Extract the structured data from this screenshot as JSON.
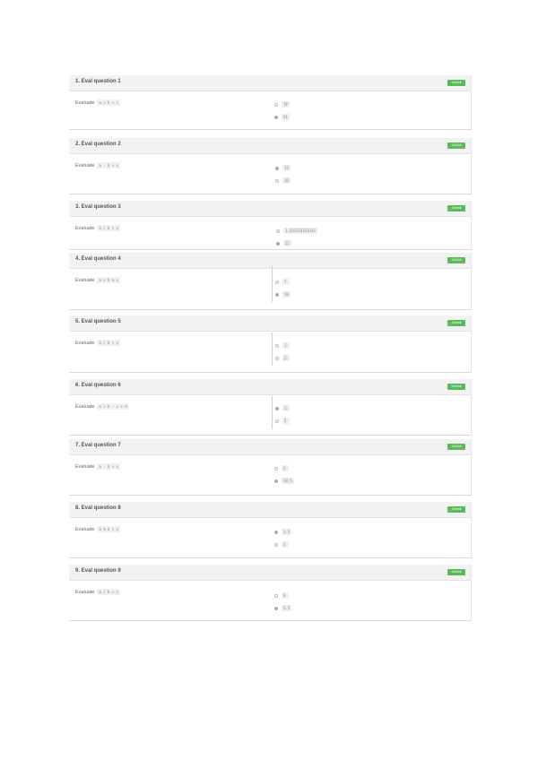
{
  "status_color": "#5cb85c",
  "questions": [
    {
      "title": "1. Eval question 1",
      "eval_label": "Evaluate",
      "code": "a < b + c",
      "status": "Submit",
      "options": [
        {
          "text": "T#",
          "checked": false
        },
        {
          "text": "S1",
          "checked": true
        }
      ]
    },
    {
      "title": "2. Eval question 2",
      "eval_label": "Evaluate",
      "code": "a - b + c",
      "status": "Submit",
      "options": [
        {
          "text": "15",
          "checked": true
        },
        {
          "text": "16",
          "checked": false
        }
      ]
    },
    {
      "title": "3. Eval question 3",
      "eval_label": "Evaluate",
      "code": "a / b > c",
      "status": "Submit",
      "options": [
        {
          "text": "1.333333333333",
          "checked": false
        },
        {
          "text": "11",
          "checked": true
        }
      ]
    },
    {
      "title": "4. Eval question 4",
      "eval_label": "Evaluate",
      "code": "a < b % c",
      "status": "Submit",
      "options": [
        {
          "text": "7",
          "checked": false
        },
        {
          "text": "10",
          "checked": true
        }
      ]
    },
    {
      "title": "5. Eval question 5",
      "eval_label": "Evaluate",
      "code": "a / b < c",
      "status": "Submit",
      "options": [
        {
          "text": "1",
          "checked": false
        },
        {
          "text": "2",
          "checked": false
        }
      ]
    },
    {
      "title": "6. Eval question 6",
      "eval_label": "Evaluate",
      "code": "a + b - c + d",
      "status": "Submit",
      "options": [
        {
          "text": "1",
          "checked": true
        },
        {
          "text": "5",
          "checked": false
        }
      ]
    },
    {
      "title": "7. Eval question 7",
      "eval_label": "Evaluate",
      "code": "a - b + c",
      "status": "Submit",
      "options": [
        {
          "text": "2",
          "checked": false
        },
        {
          "text": "10.5",
          "checked": true
        }
      ]
    },
    {
      "title": "8. Eval question 8",
      "eval_label": "Evaluate",
      "code": "a % b > c",
      "status": "Submit",
      "options": [
        {
          "text": "3.5",
          "checked": true
        },
        {
          "text": "3",
          "checked": false
        }
      ]
    },
    {
      "title": "9. Eval question 9",
      "eval_label": "Evaluate",
      "code": "a / b + c",
      "status": "Submit",
      "options": [
        {
          "text": "6",
          "checked": false
        },
        {
          "text": "5.5",
          "checked": true
        }
      ]
    }
  ]
}
